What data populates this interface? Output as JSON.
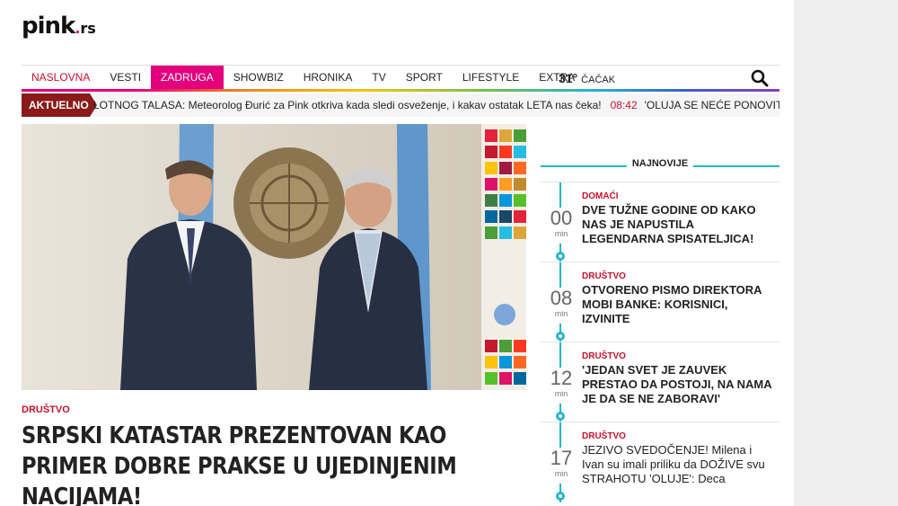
{
  "site": {
    "logo_main": "pink",
    "logo_dot": ".",
    "logo_tld": "rs"
  },
  "nav": {
    "items": [
      {
        "label": "NASLOVNA",
        "style": "red"
      },
      {
        "label": "VESTI",
        "style": "normal"
      },
      {
        "label": "ZADRUGA",
        "style": "active"
      },
      {
        "label": "SHOWBIZ",
        "style": "normal"
      },
      {
        "label": "HRONIKA",
        "style": "normal"
      },
      {
        "label": "TV",
        "style": "normal"
      },
      {
        "label": "SPORT",
        "style": "normal"
      },
      {
        "label": "LIFESTYLE",
        "style": "normal"
      },
      {
        "label": "EXTRA",
        "style": "normal"
      }
    ],
    "weather": {
      "temp": "31°",
      "city": "ČAČAK"
    },
    "accent_color": "#e4007c"
  },
  "ticker": {
    "label": "AKTUELNO",
    "item1": "LOTNOG TALASA: Meteorolog Đurić za Pink otkriva kada sledi osveženje, i kakav ostatak LETA nas čeka!",
    "time2": "08:42",
    "item2": "'OLUJA SE NEĆE PONOVITI' Selaković: Srbija"
  },
  "main": {
    "category": "DRUŠTVO",
    "headline": "SRPSKI KATASTAR PREZENTOVAN KAO PRIMER DOBRE PRAKSE U UJEDINJENIM NACIJAMA!"
  },
  "sidebar": {
    "title": "NAJNOVIJE",
    "accent_color": "#24b5c9",
    "items": [
      {
        "minutes": "00",
        "min_label": "min",
        "category": "DOMAĆI",
        "title": "DVE TUŽNE GODINE OD KAKO NAS JE NAPUSTILA LEGENDARNA SPISATELJICA!"
      },
      {
        "minutes": "08",
        "min_label": "min",
        "category": "DRUŠTVO",
        "title": "OTVORENO PISMO DIREKTORA MOBI BANKE: KORISNICI, IZVINITE"
      },
      {
        "minutes": "12",
        "min_label": "min",
        "category": "DRUŠTVO",
        "title": "'JEDAN SVET JE ZAUVEK PRESTAO DA POSTOJI, NA NAMA JE DA SE NE ZABORAVI'"
      },
      {
        "minutes": "17",
        "min_label": "min",
        "category": "DRUŠTVO",
        "title": "JEZIVO SVEDOČENJE! Milena i Ivan su imali priliku da DOŽIVE svu STRAHOTU 'OLUJE': Deca"
      }
    ]
  }
}
